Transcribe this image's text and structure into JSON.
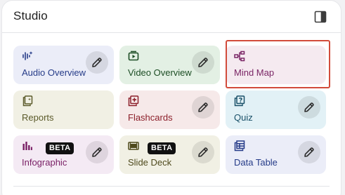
{
  "panel": {
    "title": "Studio"
  },
  "cards": [
    {
      "id": "audio-overview",
      "label": "Audio Overview",
      "icon": "audio-waveform-icon",
      "bg": "#ebedf8",
      "fg": "#253b88",
      "edit": true,
      "badge": ""
    },
    {
      "id": "video-overview",
      "label": "Video Overview",
      "icon": "video-icon",
      "bg": "#e3f0e4",
      "fg": "#1c4d24",
      "edit": true,
      "badge": ""
    },
    {
      "id": "mind-map",
      "label": "Mind Map",
      "icon": "mind-map-icon",
      "bg": "#f5eaf0",
      "fg": "#7a2565",
      "edit": false,
      "badge": ""
    },
    {
      "id": "reports",
      "label": "Reports",
      "icon": "reports-icon",
      "bg": "#f1f0e4",
      "fg": "#5b5a2a",
      "edit": false,
      "badge": ""
    },
    {
      "id": "flashcards",
      "label": "Flashcards",
      "icon": "flashcards-icon",
      "bg": "#f6e9e9",
      "fg": "#8c1f2a",
      "edit": true,
      "badge": ""
    },
    {
      "id": "quiz",
      "label": "Quiz",
      "icon": "quiz-icon",
      "bg": "#e2f1f6",
      "fg": "#195068",
      "edit": true,
      "badge": ""
    },
    {
      "id": "infographic",
      "label": "Infographic",
      "icon": "infographic-icon",
      "bg": "#f4eaf4",
      "fg": "#7a2066",
      "edit": true,
      "badge": "BETA"
    },
    {
      "id": "slide-deck",
      "label": "Slide Deck",
      "icon": "slide-deck-icon",
      "bg": "#f1f0e4",
      "fg": "#4f4a1d",
      "edit": true,
      "badge": "BETA"
    },
    {
      "id": "data-table",
      "label": "Data Table",
      "icon": "data-table-icon",
      "bg": "#ebedf8",
      "fg": "#253b88",
      "edit": true,
      "badge": ""
    }
  ],
  "highlight_color": "#d24b3b"
}
